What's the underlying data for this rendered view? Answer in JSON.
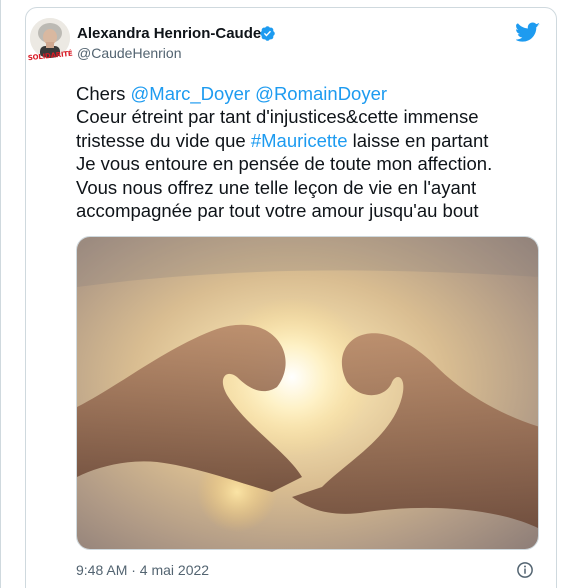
{
  "tweet": {
    "author": {
      "display_name": "Alexandra Henrion-Caude",
      "handle": "@CaudeHenrion",
      "avatar_badge": "SOLIDARITÉ",
      "verified": true
    },
    "text": {
      "word_chers": "Chers",
      "mention_1": "@Marc_Doyer",
      "mention_2": "@RomainDoyer",
      "line_2": "Coeur étreint par tant d'injustices&cette immense",
      "line_3_before": "tristesse du vide que ",
      "hashtag": "#Mauricette",
      "line_3_after": " laisse en partant",
      "line_4": "Je vous entoure en pensée de toute mon affection.",
      "line_5": "Vous nous offrez une telle leçon de vie en l'ayant",
      "line_6": "accompagnée par tout votre amour jusqu'au bout"
    },
    "media": {
      "icon": "heart-hands-photo"
    },
    "timestamp": "9:48 AM · 4 mai 2022"
  },
  "colors": {
    "link": "#1d9bf0",
    "twitter_brand": "#1d9bf0",
    "verified": "#1d9bf0",
    "secondary_text": "#536471",
    "border": "#cfd9de"
  },
  "icons": {
    "brand": "twitter-bird-icon",
    "verified": "verified-badge-icon",
    "info": "info-icon"
  }
}
